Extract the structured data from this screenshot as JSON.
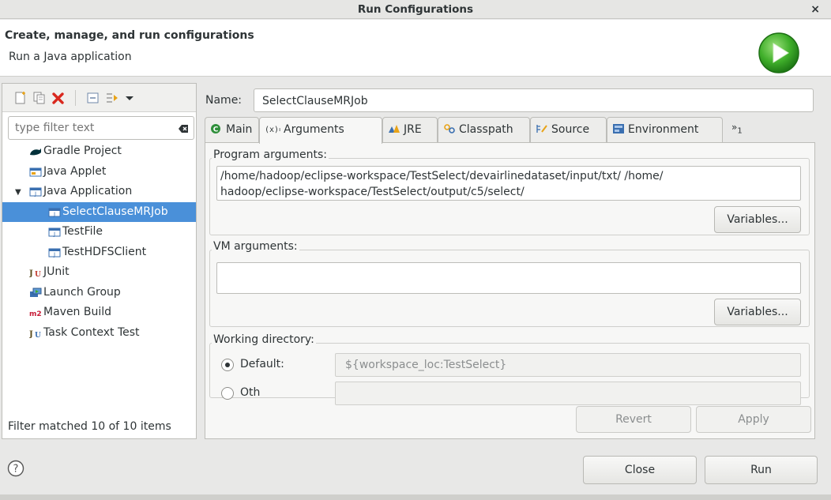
{
  "window": {
    "title": "Run Configurations",
    "close_label": "×"
  },
  "header": {
    "title": "Create, manage, and run configurations",
    "subtitle": "Run a Java application"
  },
  "left": {
    "toolbar_icons": [
      "new-configuration-icon",
      "duplicate-icon",
      "delete-icon",
      "collapse-all-icon",
      "filter-icon",
      "view-menu-icon"
    ],
    "filter": {
      "placeholder": "type filter text",
      "value": ""
    },
    "tree": [
      {
        "label": "Gradle Project",
        "icon": "gradle-icon",
        "indent": 0,
        "expander": false
      },
      {
        "label": "Java Applet",
        "icon": "java-applet-icon",
        "indent": 0,
        "expander": false
      },
      {
        "label": "Java Application",
        "icon": "java-application-icon",
        "indent": 0,
        "expander": true
      },
      {
        "label": "SelectClauseMRJob",
        "icon": "java-config-icon",
        "indent": 1,
        "expander": false,
        "selected": true
      },
      {
        "label": "TestFile",
        "icon": "java-config-icon",
        "indent": 1,
        "expander": false
      },
      {
        "label": "TestHDFSClient",
        "icon": "java-config-icon",
        "indent": 1,
        "expander": false
      },
      {
        "label": "JUnit",
        "icon": "junit-icon",
        "indent": 0,
        "expander": false
      },
      {
        "label": "Launch Group",
        "icon": "launch-group-icon",
        "indent": 0,
        "expander": false
      },
      {
        "label": "Maven Build",
        "icon": "maven-icon",
        "indent": 0,
        "expander": false
      },
      {
        "label": "Task Context Test",
        "icon": "task-context-icon",
        "indent": 0,
        "expander": false
      }
    ],
    "status": "Filter matched 10 of 10 items"
  },
  "right": {
    "name_label": "Name:",
    "name_value": "SelectClauseMRJob",
    "tabs": [
      {
        "label": "Main",
        "icon": "main-tab-icon"
      },
      {
        "label": "Arguments",
        "icon": "arguments-tab-icon",
        "active": true
      },
      {
        "label": "JRE",
        "icon": "jre-tab-icon"
      },
      {
        "label": "Classpath",
        "icon": "classpath-tab-icon"
      },
      {
        "label": "Source",
        "icon": "source-tab-icon"
      },
      {
        "label": "Environment",
        "icon": "environment-tab-icon"
      }
    ],
    "more_tabs": {
      "symbol": "»",
      "count": "1"
    },
    "program_args": {
      "label": "Program arguments:",
      "line1": "/home/hadoop/eclipse-workspace/TestSelect/devairlinedataset/input/txt/ /home/",
      "line2": "hadoop/eclipse-workspace/TestSelect/output/c5/select/",
      "variables_label": "Variables..."
    },
    "vm_args": {
      "label": "VM arguments:",
      "value": "",
      "variables_label": "Variables..."
    },
    "working_dir": {
      "label": "Working directory:",
      "default_label": "Default:",
      "default_value": "${workspace_loc:TestSelect}",
      "other_label": "Oth"
    },
    "revert_label": "Revert",
    "apply_label": "Apply"
  },
  "footer": {
    "close_label": "Close",
    "run_label": "Run"
  },
  "colors": {
    "selection": "#4a90d9",
    "run_green": "#3fae2a"
  }
}
